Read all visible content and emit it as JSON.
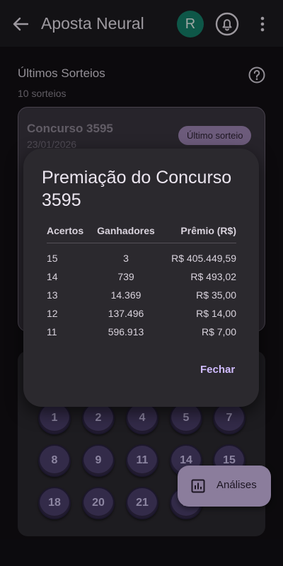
{
  "appbar": {
    "title": "Aposta Neural",
    "avatar_initial": "R"
  },
  "section": {
    "title": "Últimos Sorteios",
    "subtitle": "10 sorteios"
  },
  "draw_card": {
    "title": "Concurso 3595",
    "date": "23/01/2026",
    "badge": "Último sorteio"
  },
  "balls": [
    {
      "label": "1"
    },
    {
      "label": "2"
    },
    {
      "label": "4"
    },
    {
      "label": "5"
    },
    {
      "label": "7"
    },
    {
      "label": "8"
    },
    {
      "label": "9"
    },
    {
      "label": "11"
    },
    {
      "label": "14"
    },
    {
      "label": "15"
    },
    {
      "label": "18"
    },
    {
      "label": "20"
    },
    {
      "label": "21"
    },
    {
      "label": "2"
    }
  ],
  "fab": {
    "label": "Análises"
  },
  "dialog": {
    "title": "Premiação do Concurso 3595",
    "headers": {
      "hits": "Acertos",
      "winners": "Ganhadores",
      "prize": "Prêmio (R$)"
    },
    "rows": [
      {
        "hits": "15",
        "winners": "3",
        "prize": "R$ 405.449,59"
      },
      {
        "hits": "14",
        "winners": "739",
        "prize": "R$ 493,02"
      },
      {
        "hits": "13",
        "winners": "14.369",
        "prize": "R$ 35,00"
      },
      {
        "hits": "12",
        "winners": "137.496",
        "prize": "R$ 14,00"
      },
      {
        "hits": "11",
        "winners": "596.913",
        "prize": "R$ 7,00"
      }
    ],
    "close_label": "Fechar"
  },
  "colors": {
    "accent": "#d0bcff",
    "avatar": "#16806a",
    "fab": "#cdb9e6",
    "badge": "#9f87b6",
    "ball": "#4c406c"
  }
}
